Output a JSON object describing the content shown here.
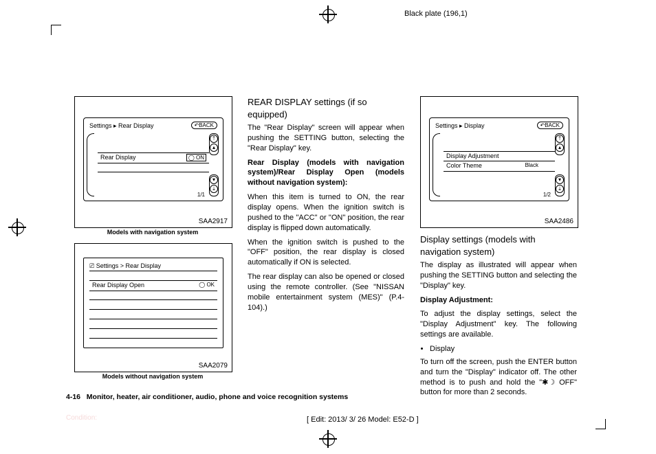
{
  "header": {
    "plate": "Black plate (196,1)"
  },
  "footer": {
    "edit": "[ Edit: 2013/ 3/ 26   Model: E52-D ]",
    "condition": "Condition:"
  },
  "page_footer": {
    "num": "4-16",
    "section": "Monitor, heater, air conditioner, audio, phone and voice recognition systems"
  },
  "fig1": {
    "code": "SAA2917",
    "caption": "Models with navigation system",
    "breadcrumb": "Settings ▸ Rear Display",
    "back": "↶BACK",
    "row_label": "Rear Display",
    "row_state": "◯ ON",
    "pager": "1/1"
  },
  "fig2": {
    "code": "SAA2079",
    "caption": "Models without navigation system",
    "breadcrumb": "⎚ Settings > Rear Display",
    "row_label": "Rear Display Open",
    "row_state": "◯      OK"
  },
  "fig3": {
    "code": "SAA2486",
    "breadcrumb": "Settings ▸ Display",
    "back": "↶BACK",
    "row1_label": "Display Adjustment",
    "row2_label": "Color Theme",
    "row2_value": "Black",
    "pager": "1/2"
  },
  "colA": {
    "h": "REAR DISPLAY settings (if so equipped)",
    "p1": "The \"Rear Display\" screen will appear when pushing the SETTING button, selecting the \"Rear Display\" key.",
    "sub1": "Rear Display (models with navigation system)/Rear Display Open (models without navigation system):",
    "p2": "When this item is turned to ON, the rear display opens. When the ignition switch is pushed to the \"ACC\" or \"ON\" position, the rear display is flipped down automatically.",
    "p3": "When the ignition switch is pushed to the \"OFF\" position, the rear display is closed automatically if ON is selected.",
    "p4": "The rear display can also be opened or closed using the remote controller. (See \"NISSAN mobile entertainment system (MES)\" (P.4-104).)"
  },
  "colB": {
    "h": "Display settings (models with navigation system)",
    "p1": "The display as illustrated will appear when pushing the SETTING button and selecting the \"Display\" key.",
    "sub1": "Display Adjustment:",
    "p2": "To adjust the display settings, select the \"Display Adjustment\" key. The following settings are available.",
    "li1": "Display",
    "p3a": "To turn off the screen, push the ENTER button and turn the \"Display\" indicator off. The other method is to push and hold the \"",
    "p3b": " OFF\" button for more than 2 seconds."
  }
}
